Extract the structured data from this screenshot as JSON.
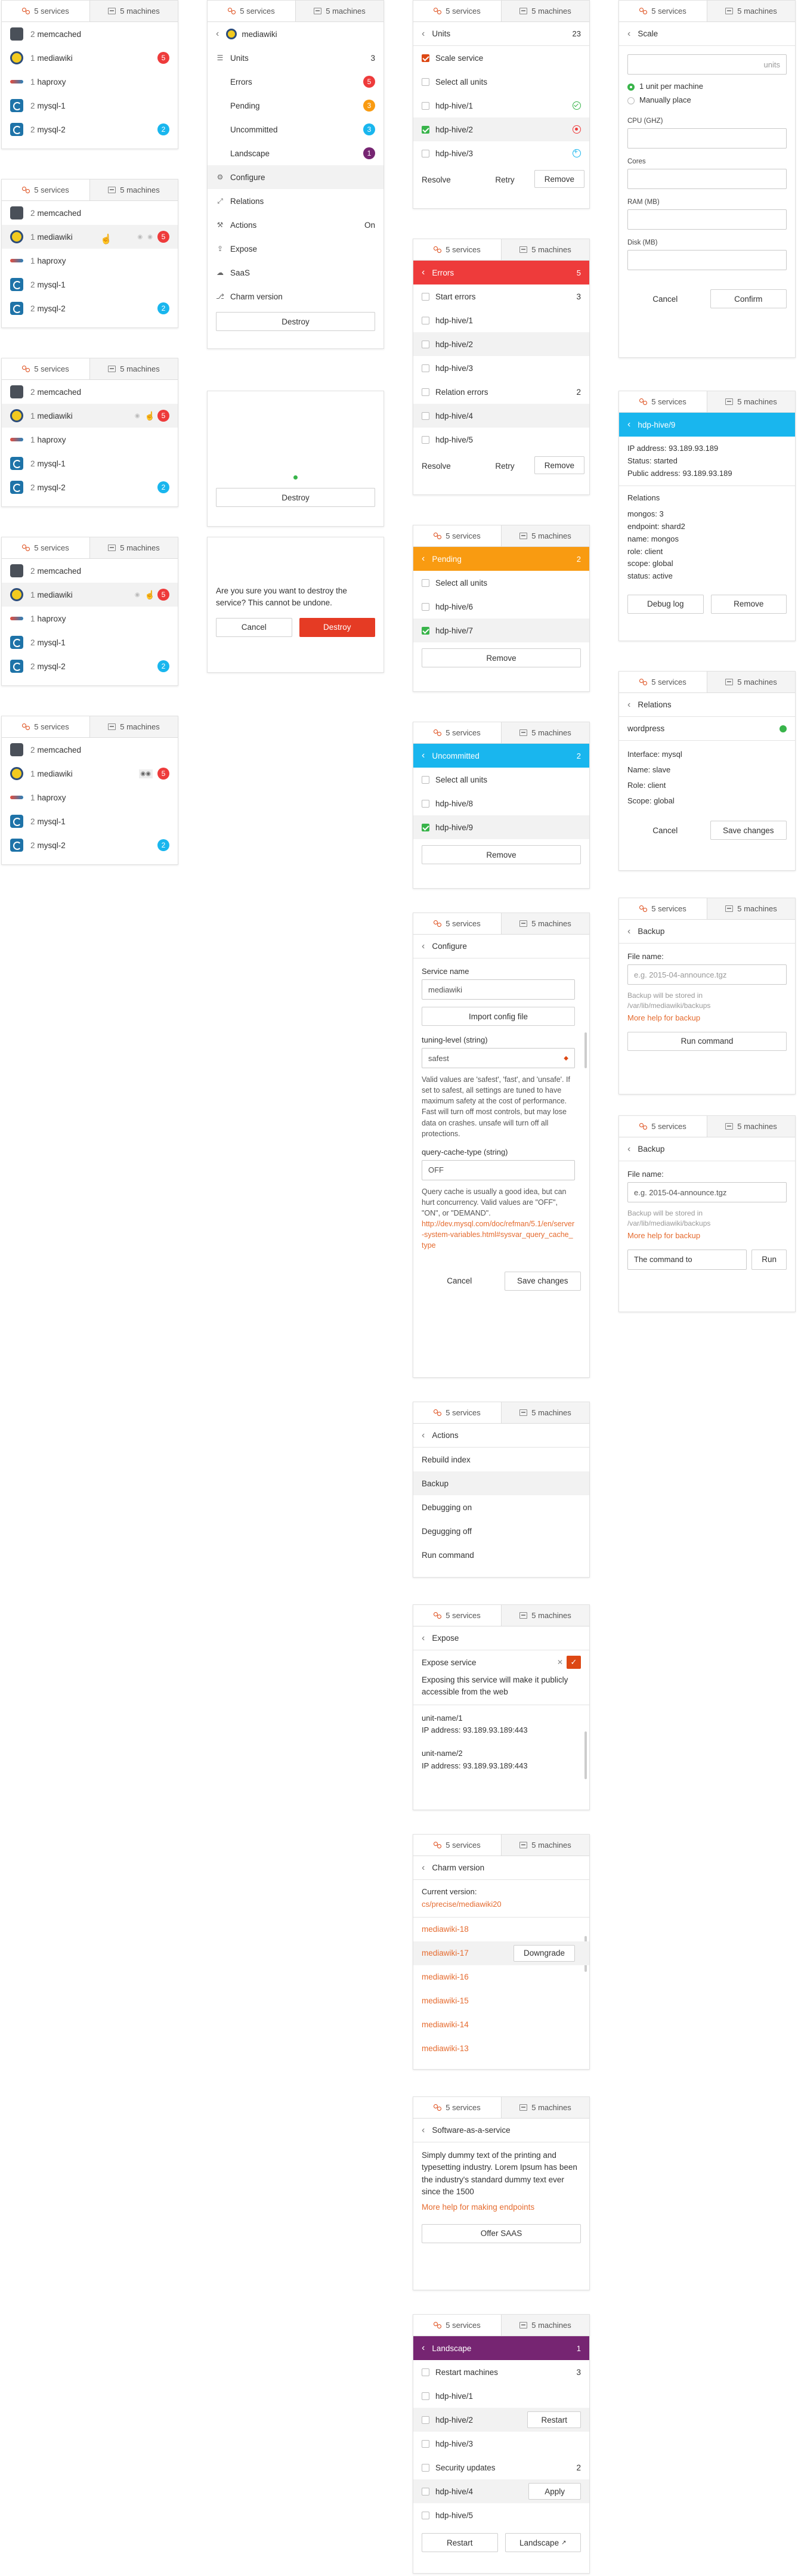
{
  "tabs": {
    "services": "5 services",
    "machines": "5 machines"
  },
  "services": [
    {
      "n": "2",
      "name": "memcached"
    },
    {
      "n": "1",
      "name": "mediawiki",
      "badge": "5"
    },
    {
      "n": "1",
      "name": "haproxy"
    },
    {
      "n": "2",
      "name": "mysql-1"
    },
    {
      "n": "2",
      "name": "mysql-2",
      "badge": "2"
    }
  ],
  "mediawiki_menu": {
    "name": "mediawiki",
    "items": [
      {
        "label": "Units",
        "count": "3"
      },
      {
        "label": "Errors",
        "count": "5"
      },
      {
        "label": "Pending",
        "count": "3"
      },
      {
        "label": "Uncommitted",
        "count": "3"
      },
      {
        "label": "Landscape",
        "count": "1"
      },
      {
        "label": "Configure"
      },
      {
        "label": "Relations"
      },
      {
        "label": "Actions",
        "count": "On"
      },
      {
        "label": "Expose"
      },
      {
        "label": "SaaS"
      },
      {
        "label": "Charm version"
      }
    ],
    "destroy": "Destroy"
  },
  "destroy_confirm": {
    "text": "Are you sure you want to destroy the service? This cannot be undone.",
    "cancel": "Cancel",
    "destroy": "Destroy"
  },
  "units": {
    "title": "Units",
    "count": "23",
    "scale": "Scale service",
    "select_all": "Select all units",
    "items": [
      "hdp-hive/1",
      "hdp-hive/2",
      "hdp-hive/3"
    ],
    "resolve": "Resolve",
    "retry": "Retry",
    "remove": "Remove"
  },
  "errors": {
    "title": "Errors",
    "count": "5",
    "start": "Start errors",
    "start_count": "3",
    "start_items": [
      "hdp-hive/1",
      "hdp-hive/2",
      "hdp-hive/3"
    ],
    "rel": "Relation errors",
    "rel_count": "2",
    "rel_items": [
      "hdp-hive/4",
      "hdp-hive/5"
    ],
    "resolve": "Resolve",
    "retry": "Retry",
    "remove": "Remove"
  },
  "pending": {
    "title": "Pending",
    "count": "2",
    "select_all": "Select all units",
    "items": [
      "hdp-hive/6",
      "hdp-hive/7"
    ],
    "remove": "Remove"
  },
  "uncommitted": {
    "title": "Uncommitted",
    "count": "2",
    "select_all": "Select all units",
    "items": [
      "hdp-hive/8",
      "hdp-hive/9"
    ],
    "remove": "Remove"
  },
  "configure": {
    "title": "Configure",
    "service_name_label": "Service name",
    "service_name": "mediawiki",
    "import": "Import config file",
    "tuning_label": "tuning-level (string)",
    "tuning_value": "safest",
    "tuning_help": "Valid values are 'safest', 'fast', and 'unsafe'. If set to safest, all settings are tuned to have maximum safety at the cost of performance. Fast will turn off most controls, but may lose data on crashes. unsafe will turn off all protections.",
    "cache_label": "query-cache-type (string)",
    "cache_value": "OFF",
    "cache_help": "Query cache is usually a good idea, but can hurt concurrency. Valid values are \"OFF\", \"ON\", or \"DEMAND\".",
    "cache_link": "http://dev.mysql.com/doc/refman/5.1/en/server-system-variables.html#sysvar_query_cache_type",
    "cancel": "Cancel",
    "save": "Save changes"
  },
  "actions": {
    "title": "Actions",
    "items": [
      "Rebuild index",
      "Backup",
      "Debugging on",
      "Degugging off",
      "Run command"
    ]
  },
  "expose": {
    "title": "Expose",
    "label": "Expose service",
    "text": "Exposing this service will make it publicly accessible from the web",
    "units": [
      {
        "name": "unit-name/1",
        "ip": "IP address: 93.189.93.189:443"
      },
      {
        "name": "unit-name/2",
        "ip": "IP address: 93.189.93.189:443"
      }
    ]
  },
  "charm": {
    "title": "Charm version",
    "current_label": "Current version:",
    "current": "cs/precise/mediawiki20",
    "items": [
      "mediawiki-18",
      "mediawiki-17",
      "mediawiki-16",
      "mediawiki-15",
      "mediawiki-14",
      "mediawiki-13"
    ],
    "downgrade": "Downgrade"
  },
  "saas": {
    "title": "Software-as-a-service",
    "text": "Simply dummy text of the printing and typesetting industry. Lorem Ipsum has been the industry's standard dummy text ever since the 1500",
    "link": "More help for making endpoints",
    "offer": "Offer SAAS"
  },
  "landscape": {
    "title": "Landscape",
    "count": "1",
    "restart": "Restart machines",
    "restart_count": "3",
    "r_items": [
      "hdp-hive/1",
      "hdp-hive/2",
      "hdp-hive/3"
    ],
    "restart_btn": "Restart",
    "security": "Security updates",
    "security_count": "2",
    "s_items": [
      "hdp-hive/4",
      "hdp-hive/5"
    ],
    "apply": "Apply",
    "restart_all": "Restart",
    "landscape_btn": "Landscape"
  },
  "scale": {
    "title": "Scale",
    "units_ph": "units",
    "opt1": "1 unit per machine",
    "opt2": "Manually place",
    "cpu": "CPU (GHZ)",
    "cores": "Cores",
    "ram": "RAM (MB)",
    "disk": "Disk (MB)",
    "cancel": "Cancel",
    "confirm": "Confirm"
  },
  "unit_detail": {
    "title": "hdp-hive/9",
    "ip": "IP address: 93.189.93.189",
    "status": "Status: started",
    "public": "Public address: 93.189.93.189",
    "rel_title": "Relations",
    "rels": [
      "mongos: 3",
      "endpoint: shard2",
      "name: mongos",
      "role: client",
      "scope: global",
      "status: active"
    ],
    "debug": "Debug log",
    "remove": "Remove"
  },
  "relations": {
    "title": "Relations",
    "name": "wordpress",
    "interface": "Interface: mysql",
    "name_line": "Name: slave",
    "role": "Role: client",
    "scope": "Scope: global",
    "cancel": "Cancel",
    "save": "Save changes"
  },
  "backup1": {
    "title": "Backup",
    "file_label": "File name:",
    "placeholder": "e.g. 2015-04-announce.tgz",
    "help": "Backup will be stored in /var/lib/mediawiki/backups",
    "link": "More help for backup",
    "run": "Run command"
  },
  "backup2": {
    "title": "Backup",
    "file_label": "File name:",
    "value": "e.g. 2015-04-announce.tgz",
    "help": "Backup will be stored in /var/lib/mediawiki/backups",
    "link": "More help for backup",
    "cmd_ph": "The command to",
    "run": "Run"
  }
}
